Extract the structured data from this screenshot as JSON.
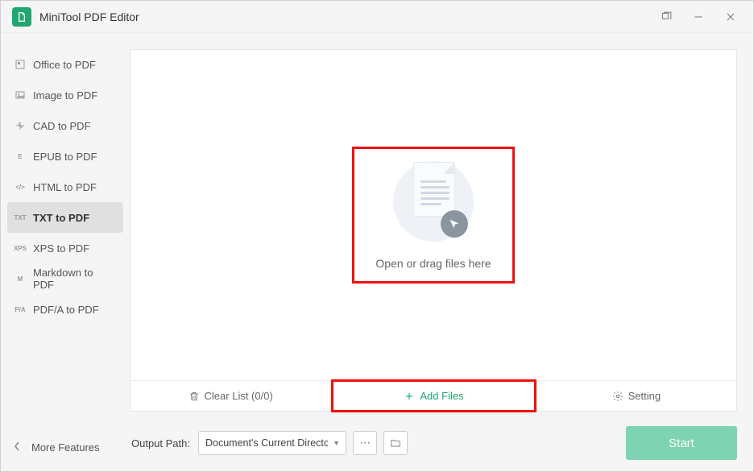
{
  "app": {
    "title": "MiniTool PDF Editor"
  },
  "sidebar": {
    "items": [
      {
        "icon": "office-icon",
        "label": "Office to PDF"
      },
      {
        "icon": "image-icon",
        "label": "Image to PDF"
      },
      {
        "icon": "cad-icon",
        "label": "CAD to PDF"
      },
      {
        "icon": "epub-icon",
        "label": "EPUB to PDF"
      },
      {
        "icon": "html-icon",
        "label": "HTML to PDF"
      },
      {
        "icon": "txt-icon",
        "label": "TXT to PDF",
        "active": true
      },
      {
        "icon": "xps-icon",
        "label": "XPS to PDF"
      },
      {
        "icon": "markdown-icon",
        "label": "Markdown to PDF"
      },
      {
        "icon": "pdfa-icon",
        "label": "PDF/A to PDF"
      }
    ],
    "more": "More Features"
  },
  "dropzone": {
    "label": "Open or drag files here"
  },
  "actions": {
    "clear": "Clear List (0/0)",
    "add": "Add Files",
    "setting": "Setting"
  },
  "output": {
    "label": "Output Path:",
    "selected": "Document's Current Directory"
  },
  "start": "Start"
}
